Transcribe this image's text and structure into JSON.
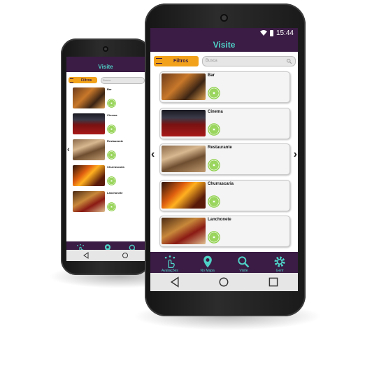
{
  "status": {
    "time": "15:44"
  },
  "app": {
    "title": "Visite"
  },
  "filters": {
    "label": "Filtros",
    "search_placeholder": "Busca"
  },
  "categories": [
    {
      "name": "Bar"
    },
    {
      "name": "Cinema"
    },
    {
      "name": "Restaurante"
    },
    {
      "name": "Churrascaria"
    },
    {
      "name": "Lanchonete"
    }
  ],
  "tabs": [
    {
      "label": "Avaliações",
      "icon": "hand-stars-icon"
    },
    {
      "label": "No Mapa",
      "icon": "map-pin-icon"
    },
    {
      "label": "Visite",
      "icon": "search-icon"
    },
    {
      "label": "Gerir",
      "icon": "gear-icon"
    }
  ],
  "colors": {
    "appbar": "#3a1c44",
    "accent": "#4fd0c6",
    "filter": "#f2a21a",
    "logo": "#8ed04a"
  }
}
